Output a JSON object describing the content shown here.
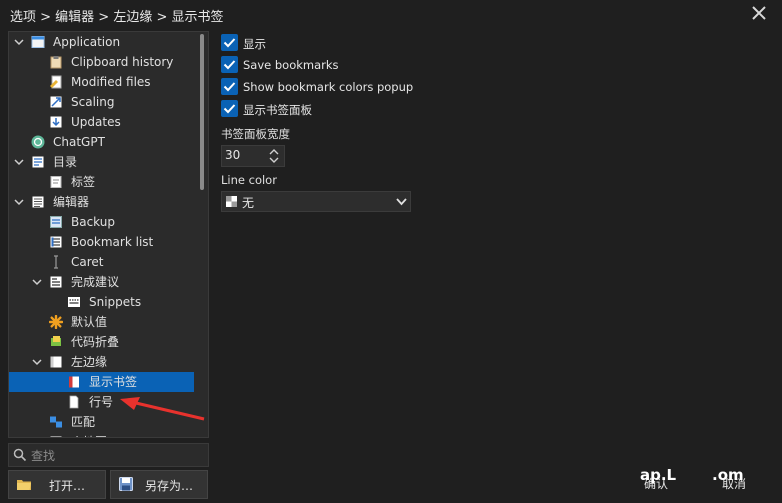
{
  "breadcrumb": "选项 > 编辑器 > 左边缘 > 显示书签",
  "tree": [
    {
      "label": "Application",
      "icon": "application-window-icon",
      "depth": 0,
      "expanded": true
    },
    {
      "label": "Clipboard history",
      "icon": "clipboard-icon",
      "depth": 1
    },
    {
      "label": "Modified files",
      "icon": "modified-files-icon",
      "depth": 1
    },
    {
      "label": "Scaling",
      "icon": "scaling-icon",
      "depth": 1
    },
    {
      "label": "Updates",
      "icon": "updates-icon",
      "depth": 1
    },
    {
      "label": "ChatGPT",
      "icon": "chatgpt-icon",
      "depth": 0
    },
    {
      "label": "目录",
      "icon": "directory-icon",
      "depth": 0,
      "expanded": true
    },
    {
      "label": "标签",
      "icon": "tags-icon",
      "depth": 1
    },
    {
      "label": "编辑器",
      "icon": "editor-icon",
      "depth": 0,
      "expanded": true
    },
    {
      "label": "Backup",
      "icon": "backup-icon",
      "depth": 1
    },
    {
      "label": "Bookmark list",
      "icon": "bookmark-list-icon",
      "depth": 1
    },
    {
      "label": "Caret",
      "icon": "caret-icon",
      "depth": 1
    },
    {
      "label": "完成建议",
      "icon": "completion-icon",
      "depth": 1,
      "expanded": true
    },
    {
      "label": "Snippets",
      "icon": "snippets-icon",
      "depth": 2
    },
    {
      "label": "默认值",
      "icon": "defaults-icon",
      "depth": 1
    },
    {
      "label": "代码折叠",
      "icon": "code-folding-icon",
      "depth": 1
    },
    {
      "label": "左边缘",
      "icon": "gutter-icon",
      "depth": 1,
      "expanded": true
    },
    {
      "label": "显示书签",
      "icon": "bookmark-icon",
      "depth": 2,
      "selected": true
    },
    {
      "label": "行号",
      "icon": "line-numbers-icon",
      "depth": 2
    },
    {
      "label": "匹配",
      "icon": "match-icon",
      "depth": 1
    },
    {
      "label": "小地图",
      "icon": "minimap-icon",
      "depth": 1
    }
  ],
  "search": {
    "placeholder": "查找"
  },
  "buttons": {
    "open": "打开…",
    "save_as": "另存为…",
    "ok": "确认",
    "cancel": "取消"
  },
  "options": [
    {
      "label": "显示",
      "checked": true
    },
    {
      "label": "Save bookmarks",
      "checked": true
    },
    {
      "label": "Show bookmark colors popup",
      "checked": true
    },
    {
      "label": "显示书签面板",
      "checked": true
    }
  ],
  "panel_width": {
    "label": "书签面板宽度",
    "value": "30"
  },
  "line_color": {
    "label": "Line color",
    "value": "无"
  },
  "watermark": {
    "left": "ap.L",
    "right": ".om"
  },
  "colors": {
    "accent": "#0a62b5",
    "background": "#1f1f1f",
    "panel": "#2b2b2b",
    "arrow": "#e8322d"
  }
}
